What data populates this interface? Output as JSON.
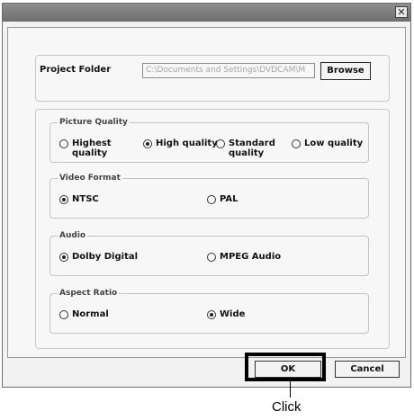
{
  "dialog": {
    "close_glyph": "✕",
    "project_folder": {
      "label": "Project Folder",
      "value": "C:\\Documents and Settings\\DVDCAM\\M",
      "browse_label": "Browse"
    },
    "picture_quality": {
      "legend": "Picture Quality",
      "options": [
        {
          "line1": "Highest",
          "line2": "quality",
          "checked": false
        },
        {
          "line1": "High quality",
          "line2": "",
          "checked": true
        },
        {
          "line1": "Standard",
          "line2": "quality",
          "checked": false
        },
        {
          "line1": "Low quality",
          "line2": "",
          "checked": false
        }
      ]
    },
    "video_format": {
      "legend": "Video Format",
      "options": [
        {
          "label": "NTSC",
          "checked": true
        },
        {
          "label": "PAL",
          "checked": false
        }
      ]
    },
    "audio": {
      "legend": "Audio",
      "options": [
        {
          "label": "Dolby Digital",
          "checked": true
        },
        {
          "label": "MPEG Audio",
          "checked": false
        }
      ]
    },
    "aspect_ratio": {
      "legend": "Aspect Ratio",
      "options": [
        {
          "label": "Normal",
          "checked": false
        },
        {
          "label": "Wide",
          "checked": true
        }
      ]
    },
    "buttons": {
      "ok_label": "OK",
      "cancel_label": "Cancel"
    }
  },
  "annotation": {
    "callout_text": "Click"
  }
}
